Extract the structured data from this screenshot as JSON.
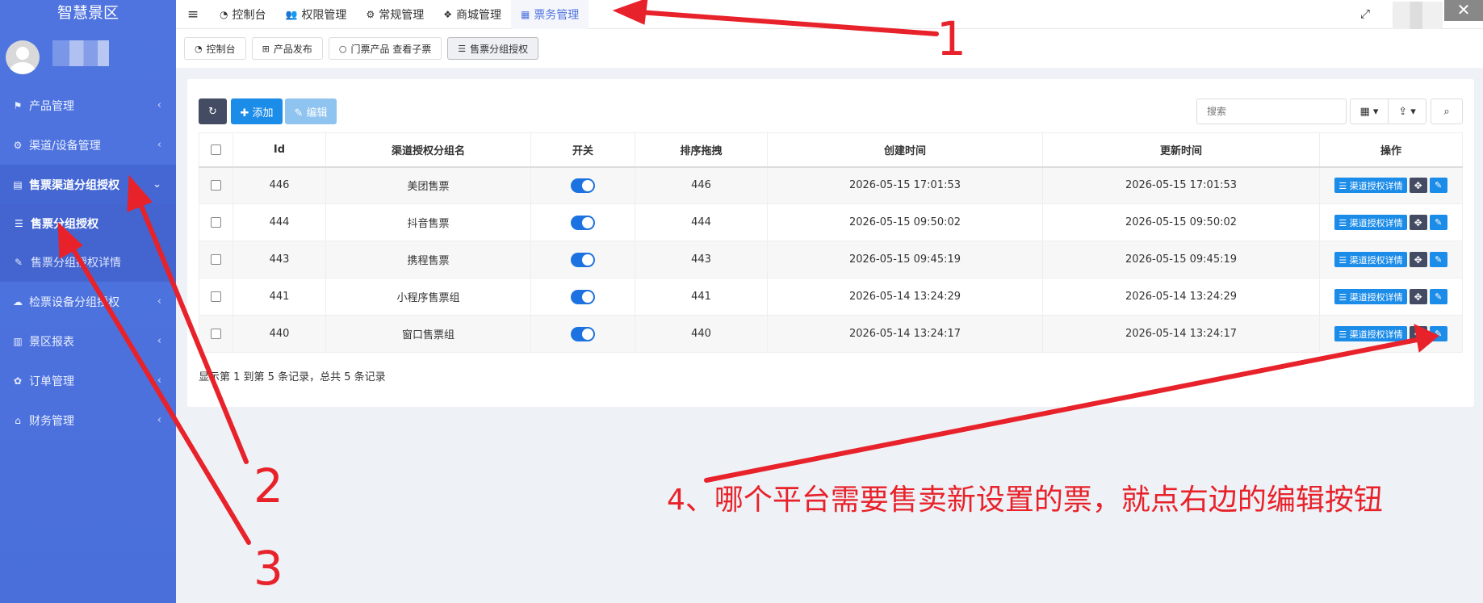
{
  "sidebar": {
    "brand": "智慧景区",
    "menu": [
      {
        "label": "产品管理",
        "icon": "tag-icon",
        "glyph": "⚑",
        "chevron": "‹"
      },
      {
        "label": "渠道/设备管理",
        "icon": "cogs-icon",
        "glyph": "⚙",
        "chevron": "‹"
      },
      {
        "label": "售票渠道分组授权",
        "icon": "database-icon",
        "glyph": "▤",
        "chevron": "⌄"
      },
      {
        "label": "检票设备分组授权",
        "icon": "cloud-icon",
        "glyph": "☁",
        "chevron": "‹"
      },
      {
        "label": "景区报表",
        "icon": "bar-chart-icon",
        "glyph": "▥",
        "chevron": "‹"
      },
      {
        "label": "订单管理",
        "icon": "paw-icon",
        "glyph": "✿",
        "chevron": "‹"
      },
      {
        "label": "财务管理",
        "icon": "bank-icon",
        "glyph": "⌂",
        "chevron": "‹"
      }
    ],
    "submenu": [
      {
        "label": "售票分组授权",
        "icon": "sliders-icon",
        "glyph": "☰"
      },
      {
        "label": "售票分组授权详情",
        "icon": "wrench-icon",
        "glyph": "✎"
      }
    ]
  },
  "topnav": {
    "items": [
      {
        "label": "控制台",
        "icon": "dashboard-icon",
        "glyph": "◔"
      },
      {
        "label": "权限管理",
        "icon": "users-icon",
        "glyph": "👥"
      },
      {
        "label": "常规管理",
        "icon": "cogs-icon",
        "glyph": "⚙"
      },
      {
        "label": "商城管理",
        "icon": "dropbox-icon",
        "glyph": "❖"
      },
      {
        "label": "票务管理",
        "icon": "grid-icon",
        "glyph": "▦"
      }
    ],
    "menu_glyph": "≡",
    "fullscreen_glyph": "⤢",
    "close_glyph": "✕"
  },
  "subtabs": [
    {
      "label": "控制台",
      "icon": "dashboard-icon",
      "glyph": "◔"
    },
    {
      "label": "产品发布",
      "icon": "plus-square-icon",
      "glyph": "⊞"
    },
    {
      "label": "门票产品 查看子票",
      "icon": "circle-icon",
      "glyph": "○"
    },
    {
      "label": "售票分组授权",
      "icon": "sliders-icon",
      "glyph": "☰"
    }
  ],
  "toolbar": {
    "refresh_glyph": "↻",
    "add_label": "✚ 添加",
    "edit_label": "✎ 编辑",
    "search_placeholder": "搜索",
    "columns_glyph": "▦ ▾",
    "export_glyph": "⇪ ▾",
    "search_glyph": "⌕"
  },
  "table": {
    "headers": [
      "Id",
      "渠道授权分组名",
      "开关",
      "排序拖拽",
      "创建时间",
      "更新时间",
      "操作"
    ],
    "rows": [
      {
        "id": "446",
        "name": "美团售票",
        "sort": "446",
        "created": "2026-05-15 17:01:53",
        "updated": "2026-05-15 17:01:53"
      },
      {
        "id": "444",
        "name": "抖音售票",
        "sort": "444",
        "created": "2026-05-15 09:50:02",
        "updated": "2026-05-15 09:50:02"
      },
      {
        "id": "443",
        "name": "携程售票",
        "sort": "443",
        "created": "2026-05-15 09:45:19",
        "updated": "2026-05-15 09:45:19"
      },
      {
        "id": "441",
        "name": "小程序售票组",
        "sort": "441",
        "created": "2026-05-14 13:24:29",
        "updated": "2026-05-14 13:24:29"
      },
      {
        "id": "440",
        "name": "窗口售票组",
        "sort": "440",
        "created": "2026-05-14 13:24:17",
        "updated": "2026-05-14 13:24:17"
      }
    ],
    "op_detail": "☰ 渠道授权详情",
    "op_drag": "✥",
    "op_edit": "✎",
    "footer": "显示第 1 到第 5 条记录，总共 5 条记录"
  },
  "annotations": {
    "n1": "1",
    "n2": "2",
    "n3": "3",
    "note": "4、哪个平台需要售卖新设置的票，就点右边的编辑按钮",
    "color": "#e8222a"
  }
}
